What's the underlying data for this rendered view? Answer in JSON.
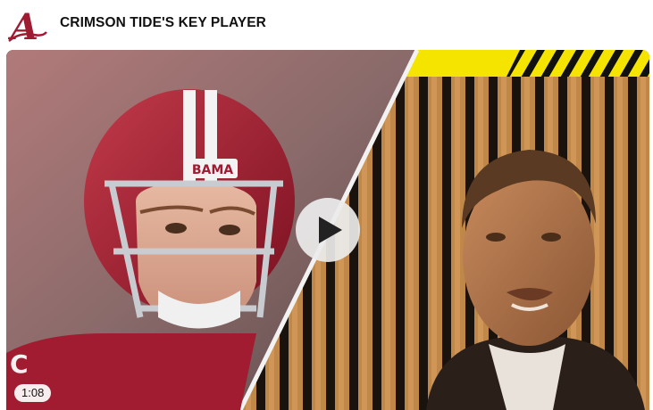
{
  "header": {
    "logo_icon": "alabama-script-a-logo",
    "title": "CRIMSON TIDE'S KEY PLAYER"
  },
  "video": {
    "duration": "1:08",
    "play_icon": "play-icon",
    "helmet_text": "BAMA",
    "jersey_letter": "C"
  },
  "colors": {
    "crimson": "#9e1b32",
    "accent_yellow": "#f5e400"
  }
}
